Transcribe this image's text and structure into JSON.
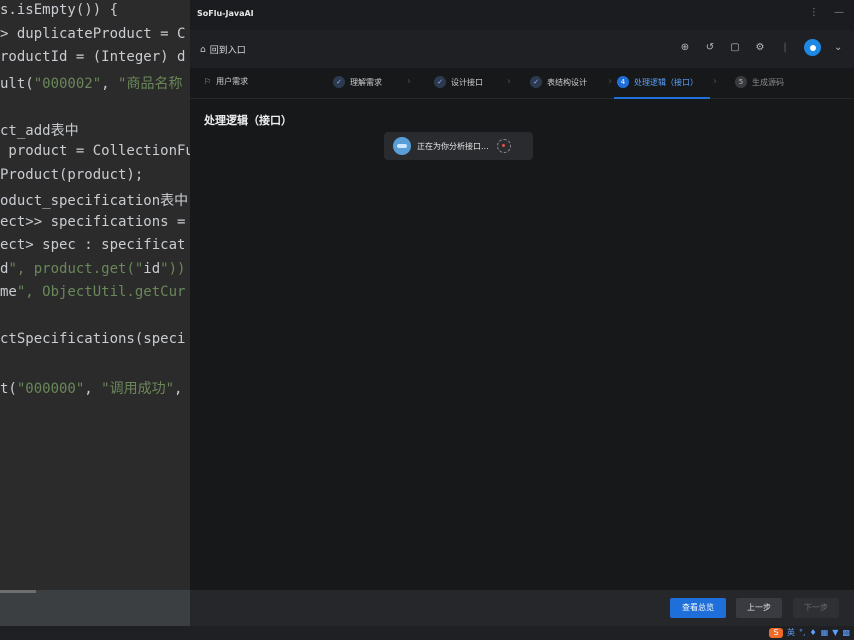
{
  "editor": {
    "lines": [
      {
        "text": "s.isEmpty()) {",
        "cls": ""
      },
      {
        "text": "> duplicateProduct = C",
        "cls": ""
      },
      {
        "text": "roductId = (Integer) d",
        "cls": ""
      },
      {
        "text": "ult(\"000002\", \"商品名称",
        "cls": "mix1"
      },
      {
        "text": "",
        "cls": ""
      },
      {
        "text": "ct_add表中",
        "cls": "c"
      },
      {
        "text": " product = CollectionFu",
        "cls": ""
      },
      {
        "text": "Product(product);",
        "cls": ""
      },
      {
        "text": "oduct_specification表中",
        "cls": "c"
      },
      {
        "text": "ect>> specifications =",
        "cls": ""
      },
      {
        "text": "ect> spec : specificat",
        "cls": ""
      },
      {
        "text": "d\", product.get(\"id\"))",
        "cls": ""
      },
      {
        "text": "me\", ObjectUtil.getCur",
        "cls": ""
      },
      {
        "text": "",
        "cls": ""
      },
      {
        "text": "ctSpecifications(speci",
        "cls": ""
      },
      {
        "text": "",
        "cls": ""
      },
      {
        "text": "t(\"000000\", \"调用成功\",",
        "cls": ""
      }
    ]
  },
  "app": {
    "title": "SoFlu-JavaAI",
    "window_buttons": [
      "⋮",
      "—"
    ],
    "back_label": "回到入口",
    "section_title": "处理逻辑（接口）",
    "toast_message": "正在为你分析接口...",
    "steps": [
      {
        "label": "用户需求",
        "state": "plain"
      },
      {
        "label": "理解需求",
        "state": "done"
      },
      {
        "label": "设计接口",
        "state": "done"
      },
      {
        "label": "表结构设计",
        "state": "done"
      },
      {
        "number": "4",
        "label": "处理逻辑（接口）",
        "state": "active"
      },
      {
        "number": "5",
        "label": "生成源码",
        "state": "todo"
      }
    ],
    "footer": {
      "primary_label": "查看总览",
      "prev_label": "上一步",
      "next_label": "下一步"
    }
  },
  "taskbar": {
    "ime_label": "英"
  },
  "colors": {
    "accent": "#1e6fd9",
    "app_background": "#17181a",
    "editor_background": "#2b2b2b"
  }
}
